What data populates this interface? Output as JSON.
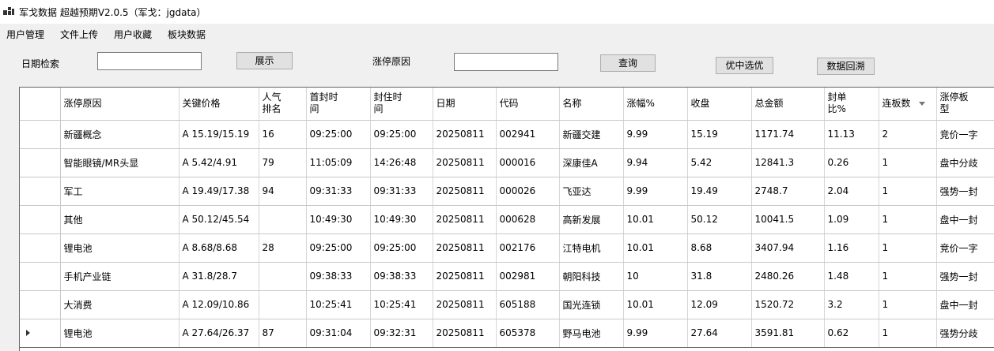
{
  "window": {
    "title": "军戈数据 超越预期V2.0.5（军戈：jgdata）"
  },
  "menu": [
    "用户管理",
    "文件上传",
    "用户收藏",
    "板块数据"
  ],
  "search": {
    "date_label": "日期检索",
    "date_value": "",
    "show_button": "展示",
    "reason_label": "涨停原因",
    "reason_value": "",
    "query_button": "查询",
    "select_button": "优中选优",
    "backtrack_button": "数据回溯"
  },
  "table": {
    "columns": [
      {
        "key": "reason",
        "label": "涨停原因"
      },
      {
        "key": "key_price",
        "label": "关键价格"
      },
      {
        "key": "popularity",
        "label": "人气\n排名"
      },
      {
        "key": "first_seal",
        "label": "首封时\n间"
      },
      {
        "key": "seal_time",
        "label": "封住时\n间"
      },
      {
        "key": "date",
        "label": "日期"
      },
      {
        "key": "code",
        "label": "代码"
      },
      {
        "key": "name",
        "label": "名称"
      },
      {
        "key": "change_pct",
        "label": "涨幅%"
      },
      {
        "key": "close",
        "label": "收盘"
      },
      {
        "key": "total_amount",
        "label": "总金额"
      },
      {
        "key": "seal_ratio",
        "label": "封单\n比%"
      },
      {
        "key": "board_count",
        "label": "连板数",
        "sort": "desc"
      },
      {
        "key": "board_type",
        "label": "涨停板\n型"
      }
    ],
    "rows": [
      {
        "reason": "新疆概念",
        "key_price": "A 15.19/15.19",
        "popularity": "16",
        "first_seal": "09:25:00",
        "seal_time": "09:25:00",
        "date": "20250811",
        "code": "002941",
        "name": "新疆交建",
        "change_pct": "9.99",
        "close": "15.19",
        "total_amount": "1171.74",
        "seal_ratio": "11.13",
        "board_count": "2",
        "board_type": "竞价一字"
      },
      {
        "reason": "智能眼镜/MR头显",
        "key_price": "A 5.42/4.91",
        "popularity": "79",
        "first_seal": "11:05:09",
        "seal_time": "14:26:48",
        "date": "20250811",
        "code": "000016",
        "name": "深康佳A",
        "change_pct": "9.94",
        "close": "5.42",
        "total_amount": "12841.3",
        "seal_ratio": "0.26",
        "board_count": "1",
        "board_type": "盘中分歧"
      },
      {
        "reason": "军工",
        "key_price": "A 19.49/17.38",
        "popularity": "94",
        "first_seal": "09:31:33",
        "seal_time": "09:31:33",
        "date": "20250811",
        "code": "000026",
        "name": "飞亚达",
        "change_pct": "9.99",
        "close": "19.49",
        "total_amount": "2748.7",
        "seal_ratio": "2.04",
        "board_count": "1",
        "board_type": "强势一封"
      },
      {
        "reason": "其他",
        "key_price": "A 50.12/45.54",
        "popularity": "",
        "first_seal": "10:49:30",
        "seal_time": "10:49:30",
        "date": "20250811",
        "code": "000628",
        "name": "高新发展",
        "change_pct": "10.01",
        "close": "50.12",
        "total_amount": "10041.5",
        "seal_ratio": "1.09",
        "board_count": "1",
        "board_type": "盘中一封"
      },
      {
        "reason": "锂电池",
        "key_price": "A 8.68/8.68",
        "popularity": "28",
        "first_seal": "09:25:00",
        "seal_time": "09:25:00",
        "date": "20250811",
        "code": "002176",
        "name": "江特电机",
        "change_pct": "10.01",
        "close": "8.68",
        "total_amount": "3407.94",
        "seal_ratio": "1.16",
        "board_count": "1",
        "board_type": "竞价一字"
      },
      {
        "reason": "手机产业链",
        "key_price": "A 31.8/28.7",
        "popularity": "",
        "first_seal": "09:38:33",
        "seal_time": "09:38:33",
        "date": "20250811",
        "code": "002981",
        "name": "朝阳科技",
        "change_pct": "10",
        "close": "31.8",
        "total_amount": "2480.26",
        "seal_ratio": "1.48",
        "board_count": "1",
        "board_type": "强势一封"
      },
      {
        "reason": "大消费",
        "key_price": "A 12.09/10.86",
        "popularity": "",
        "first_seal": "10:25:41",
        "seal_time": "10:25:41",
        "date": "20250811",
        "code": "605188",
        "name": "国光连锁",
        "change_pct": "10.01",
        "close": "12.09",
        "total_amount": "1520.72",
        "seal_ratio": "3.2",
        "board_count": "1",
        "board_type": "盘中一封"
      },
      {
        "reason": "锂电池",
        "key_price": "A 27.64/26.37",
        "popularity": "87",
        "first_seal": "09:31:04",
        "seal_time": "09:32:31",
        "date": "20250811",
        "code": "605378",
        "name": "野马电池",
        "change_pct": "9.99",
        "close": "27.64",
        "total_amount": "3591.81",
        "seal_ratio": "0.62",
        "board_count": "1",
        "board_type": "强势分歧",
        "current": true
      }
    ]
  }
}
